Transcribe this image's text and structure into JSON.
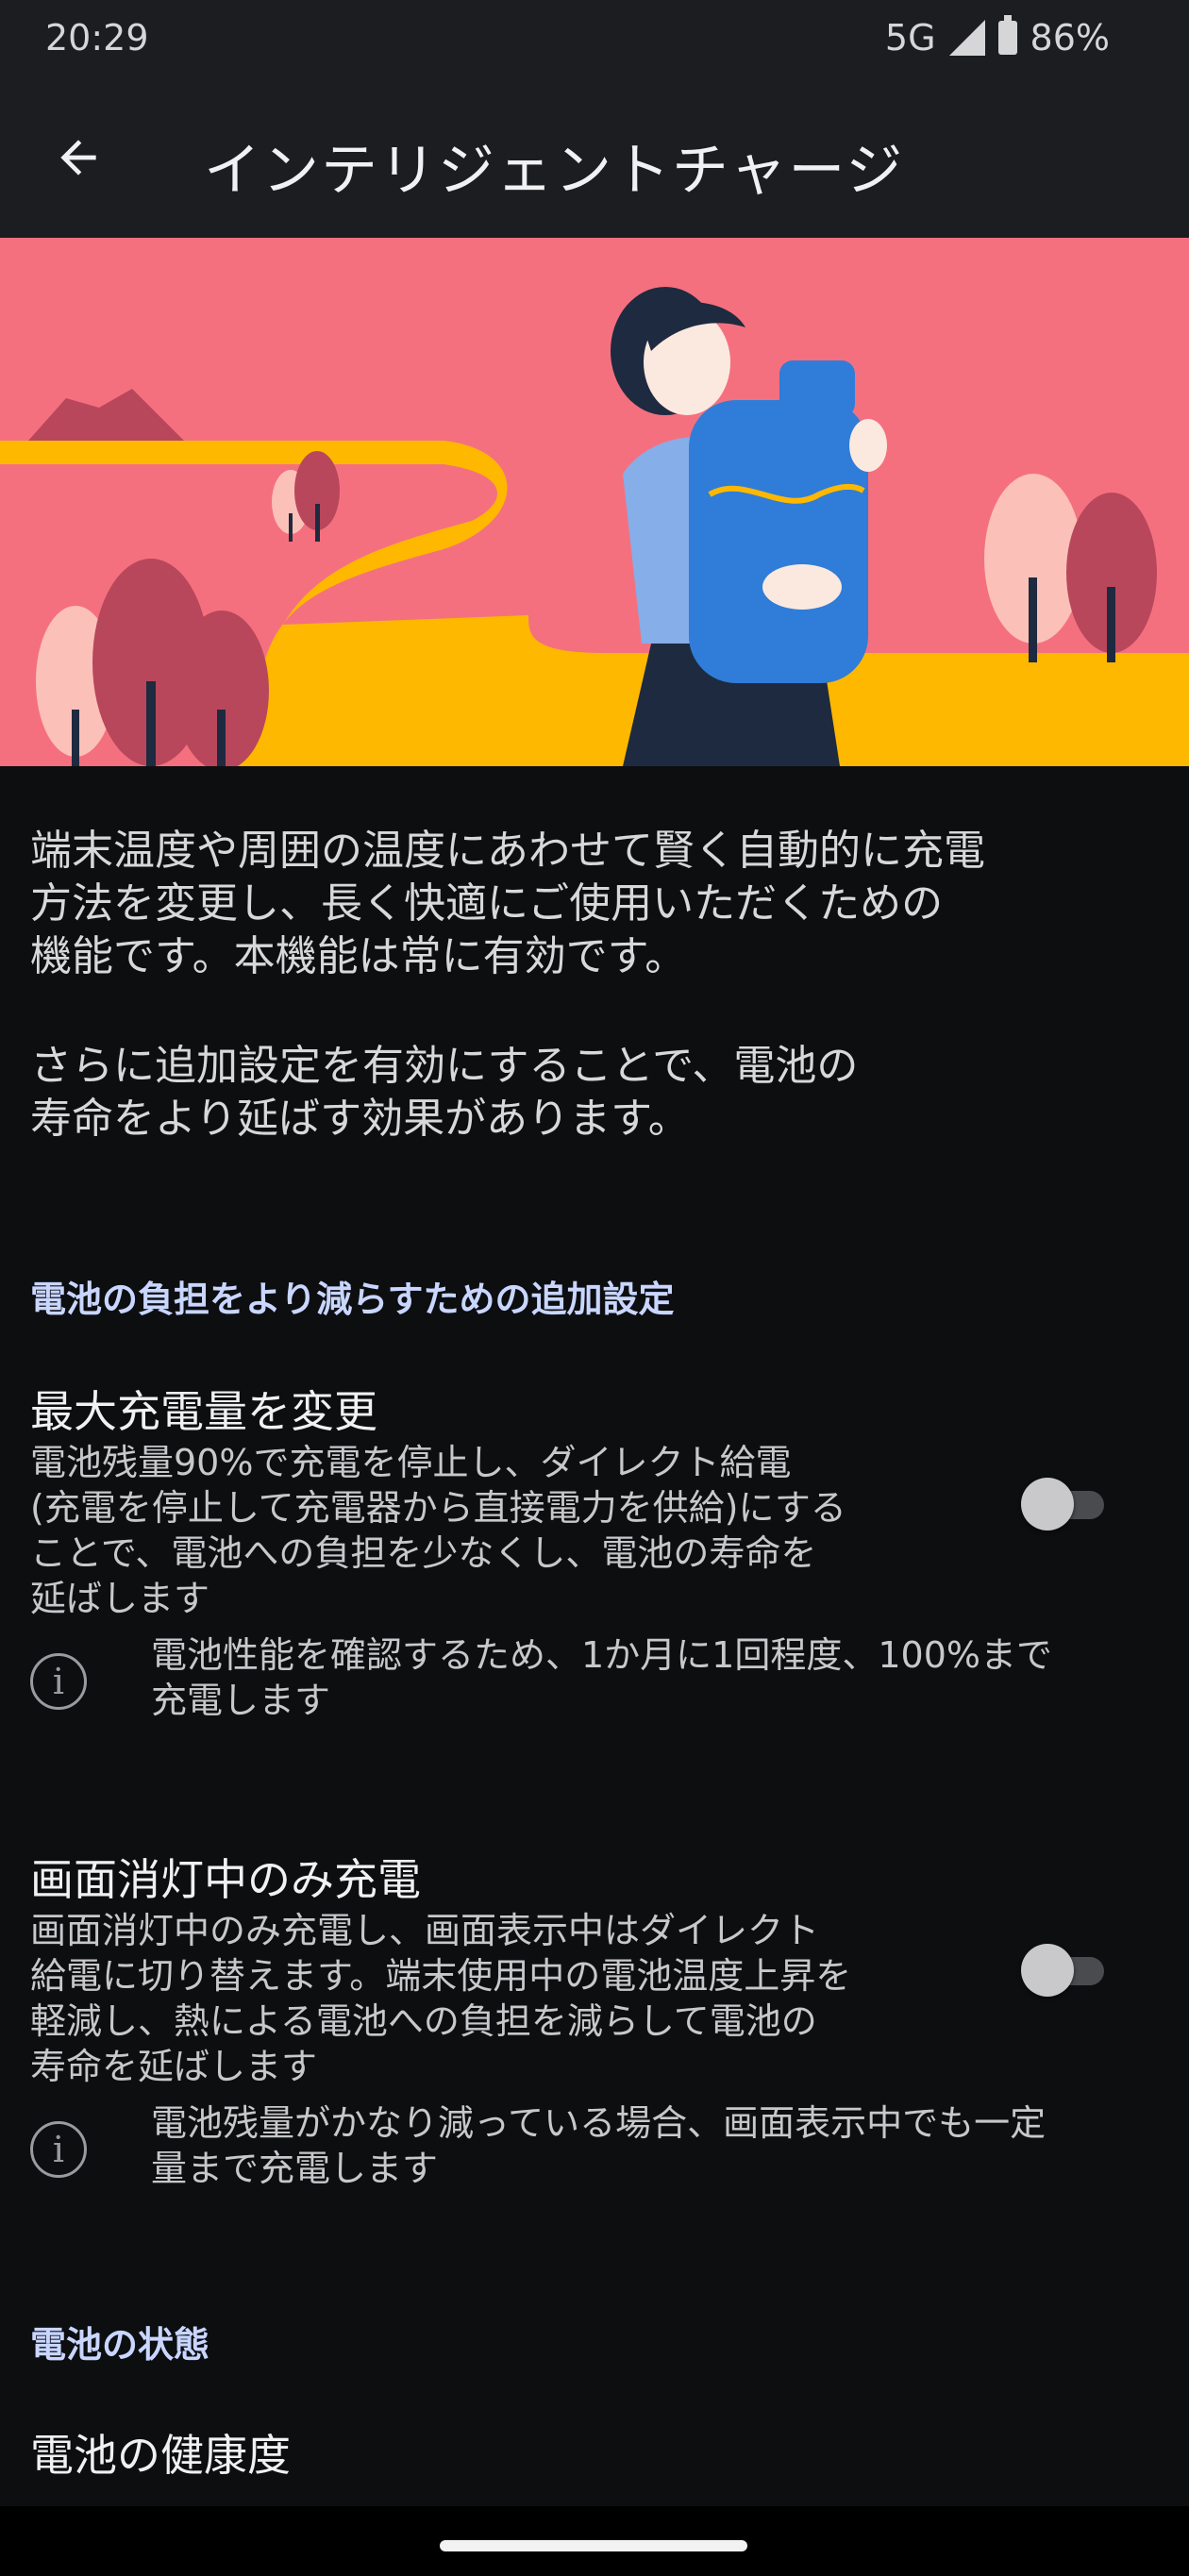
{
  "status_bar": {
    "time": "20:29",
    "network": "5G",
    "battery": "86%"
  },
  "app_bar": {
    "title": "インテリジェントチャージ",
    "back_icon": "arrow-back-icon"
  },
  "hero_image": {
    "description_icon": "illustration-person-holding-battery",
    "colors": {
      "sky": "#f5707f",
      "road": "#ffb800",
      "battery": "#2f7dd8"
    }
  },
  "intro": {
    "paragraph1": [
      "端末温度や周囲の温度にあわせて賢く自動的に充電",
      "方法を変更し、長く快適にご使用いただくための",
      "機能です。本機能は常に有効です。"
    ],
    "paragraph2": [
      "さらに追加設定を有効にすることで、電池の",
      "寿命をより延ばす効果があります。"
    ]
  },
  "section_additional": {
    "header": "電池の負担をより減らすための追加設定",
    "items": [
      {
        "title": "最大充電量を変更",
        "summary": [
          "電池残量90%で充電を停止し、ダイレクト給電",
          "(充電を停止して充電器から直接電力を供給)にする",
          "ことで、電池への負担を少なくし、電池の寿命を",
          "延ばします"
        ],
        "info": [
          "電池性能を確認するため、1か月に1回程度、100%まで",
          "充電します"
        ],
        "enabled": false
      },
      {
        "title": "画面消灯中のみ充電",
        "summary": [
          "画面消灯中のみ充電し、画面表示中はダイレクト",
          "給電に切り替えます。端末使用中の電池温度上昇を",
          "軽減し、熱による電池への負担を減らして電池の",
          "寿命を延ばします"
        ],
        "info": [
          "電池残量がかなり減っている場合、画面表示中でも一定",
          "量まで充電します"
        ],
        "enabled": false
      }
    ]
  },
  "section_status": {
    "header": "電池の状態",
    "item_title": "電池の健康度"
  },
  "info_glyph": "i",
  "accent_color": "#c9d6ff"
}
